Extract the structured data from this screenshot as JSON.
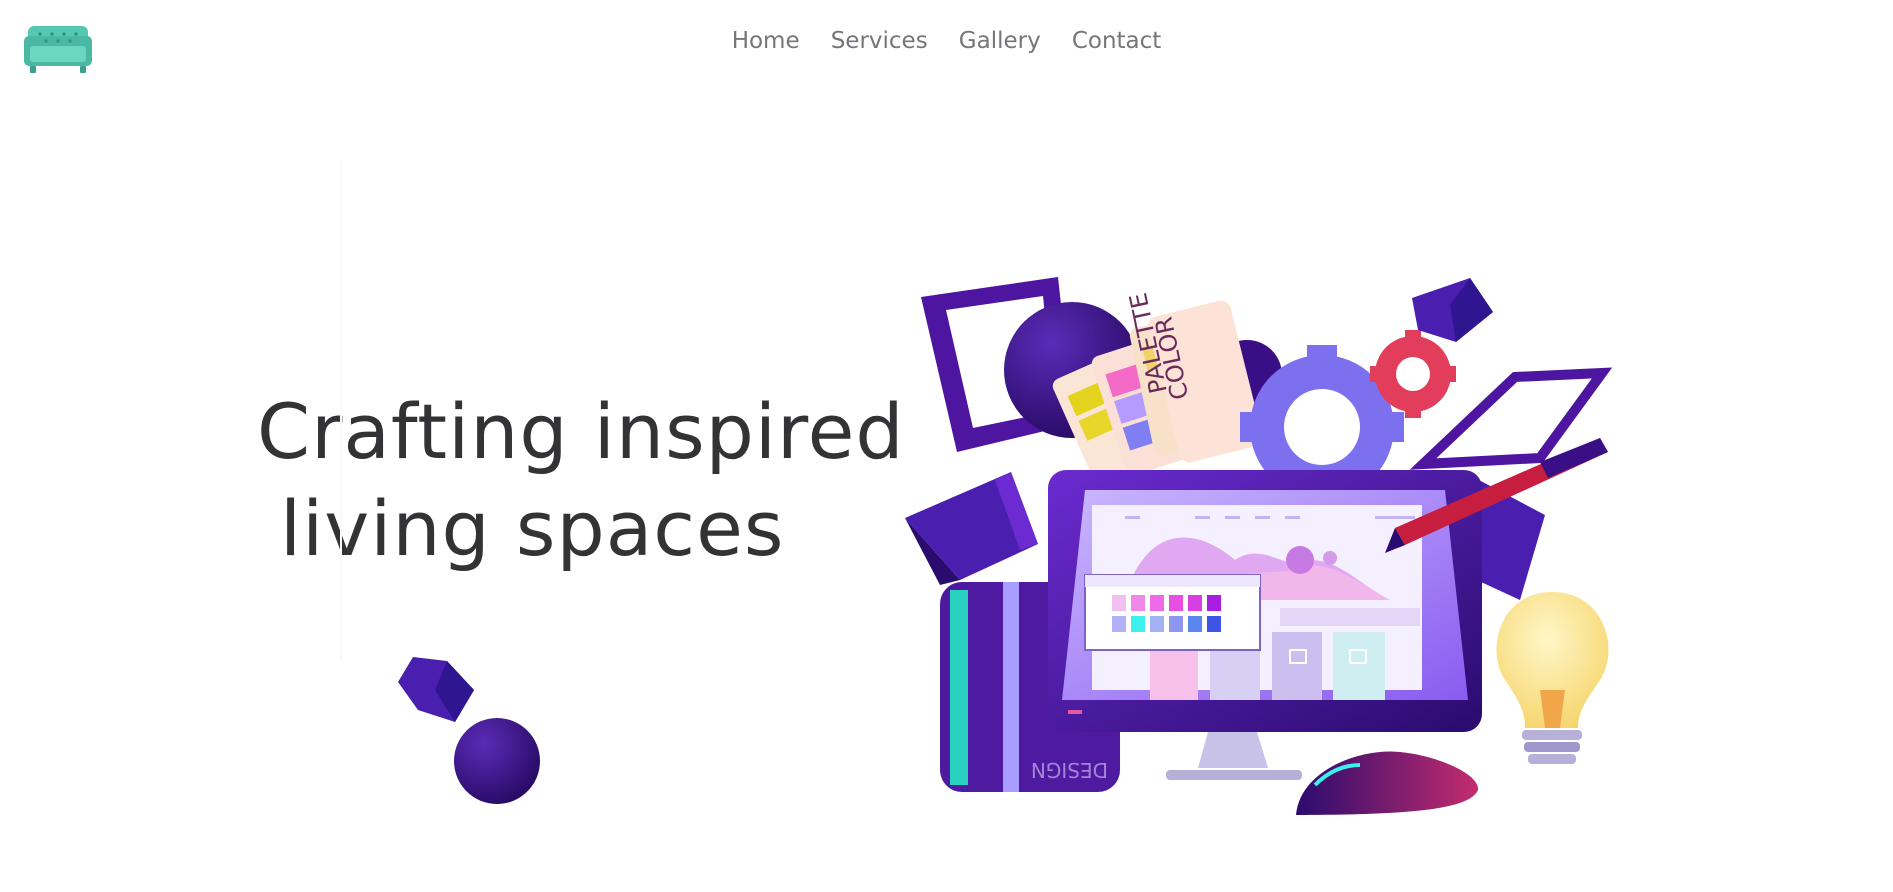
{
  "header": {
    "logo_icon": "sofa-icon",
    "nav": [
      {
        "label": "Home"
      },
      {
        "label": "Services"
      },
      {
        "label": "Gallery"
      },
      {
        "label": "Contact"
      }
    ]
  },
  "hero": {
    "title_line1": "Crafting inspired",
    "title_line2": "living spaces"
  },
  "illustration": {
    "palette_label_line1": "PALETTE",
    "palette_label_line2": "COLOR",
    "book_label": "DESIGN"
  },
  "colors": {
    "brand": "#55c8b2",
    "nav_text": "#76767a",
    "heading": "#333336",
    "purple_dark": "#3a0f86",
    "purple": "#5a1ab0",
    "violet": "#8a7cf0",
    "pink": "#f05a9e",
    "red": "#e23d5a"
  }
}
